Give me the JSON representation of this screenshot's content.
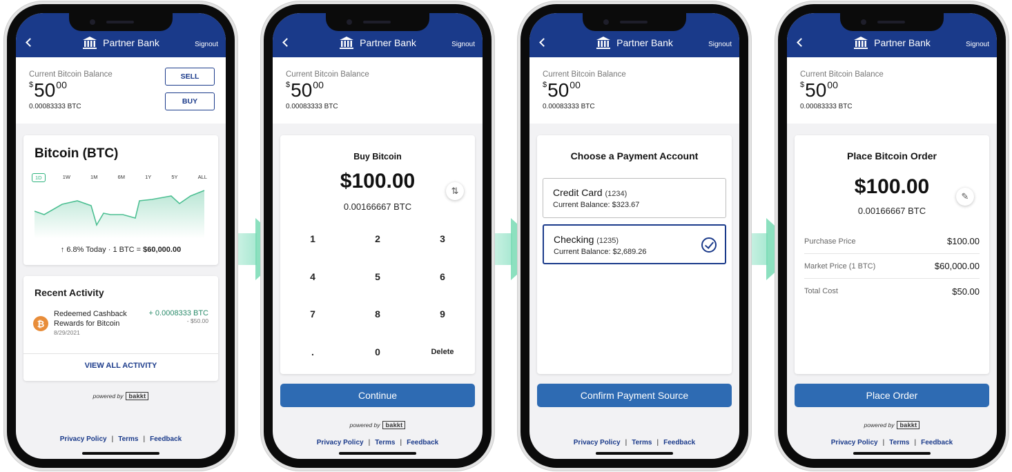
{
  "app": {
    "title": "Partner Bank",
    "signout": "Signout",
    "balance_label": "Current Bitcoin Balance",
    "balance_currency": "$",
    "balance_dollars": "50",
    "balance_cents": "00",
    "balance_btc": "0.00083333 BTC",
    "powered_by": "powered by",
    "bakkt": "bakkt",
    "footer": {
      "privacy": "Privacy Policy",
      "sep": "|",
      "terms": "Terms",
      "feedback": "Feedback"
    }
  },
  "screen1": {
    "sell": "SELL",
    "buy": "BUY",
    "chart_title": "Bitcoin (BTC)",
    "ranges": [
      "1D",
      "1W",
      "1M",
      "6M",
      "1Y",
      "5Y",
      "ALL"
    ],
    "selected_range": "1D",
    "change": "6.8% Today",
    "dot": "·",
    "rate_prefix": "1 BTC = ",
    "rate_value": "$60,000.00",
    "activity_title": "Recent Activity",
    "activity_name": "Redeemed Cashback Rewards for Bitcoin",
    "activity_date": "8/29/2021",
    "activity_btc": "+ 0.0008333 BTC",
    "activity_usd": "- $50.00",
    "coin_symbol": "₿",
    "view_all": "VIEW ALL ACTIVITY",
    "colors": {
      "accent_green": "#2db37d",
      "coin": "#e88d3a"
    }
  },
  "screen2": {
    "heading": "Buy Bitcoin",
    "amount": "$100.00",
    "btc": "0.00166667 BTC",
    "keys": [
      "1",
      "2",
      "3",
      "4",
      "5",
      "6",
      "7",
      "8",
      "9",
      ".",
      "0",
      "Delete"
    ],
    "continue": "Continue",
    "swap_icon": "⇅"
  },
  "screen3": {
    "heading": "Choose a Payment Account",
    "accounts": [
      {
        "name": "Credit Card",
        "number": "(1234)",
        "balance": "Current Balance: $323.67",
        "selected": false
      },
      {
        "name": "Checking",
        "number": "(1235)",
        "balance": "Current Balance: $2,689.26",
        "selected": true
      }
    ],
    "confirm": "Confirm Payment Source"
  },
  "screen4": {
    "heading": "Place Bitcoin Order",
    "amount": "$100.00",
    "btc": "0.00166667 BTC",
    "edit_icon": "✎",
    "rows": [
      {
        "label": "Purchase Price",
        "value": "$100.00"
      },
      {
        "label": "Market Price (1 BTC)",
        "value": "$60,000.00"
      },
      {
        "label": "Total Cost",
        "value": "$50.00"
      }
    ],
    "place_order": "Place Order"
  },
  "colors": {
    "brand_navy": "#1a3a8a",
    "button_blue": "#2e6bb3",
    "flow_arrow": "#78dab4"
  }
}
